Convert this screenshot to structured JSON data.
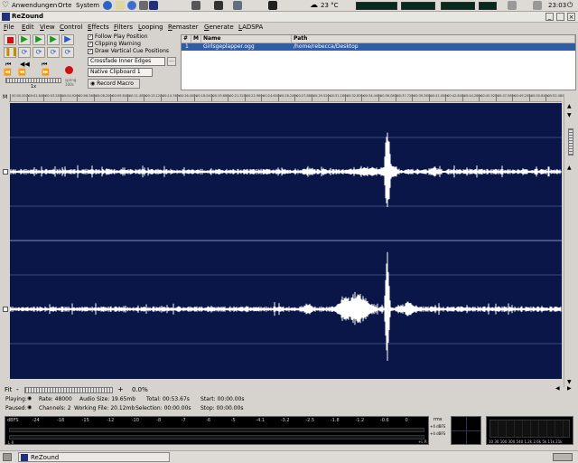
{
  "top_panel": {
    "menus": [
      "Anwendungen",
      "Orte",
      "System"
    ],
    "weather": "23 °C",
    "clock": "23:03"
  },
  "window": {
    "title": "ReZound"
  },
  "menubar": [
    "File",
    "Edit",
    "View",
    "Control",
    "Effects",
    "Filters",
    "Looping",
    "Remaster",
    "Generate",
    "LADSPA"
  ],
  "options": {
    "follow_play": "Follow Play Position",
    "clipping": "Clipping Warning",
    "vertical_cue": "Draw Vertical Cue Positions",
    "crossfade": "Crossfade Inner Edges",
    "clipboard": "Native Clipboard 1",
    "record_macro": "Record Macro",
    "more": "..."
  },
  "shuttle": {
    "label_left": "1x",
    "label_right": "spring\n100s"
  },
  "file_list": {
    "headers": [
      "#",
      "M",
      "Name",
      "Path"
    ],
    "rows": [
      {
        "num": "1",
        "name": "Girlsgeplapper.ogg",
        "path": "/home/rebecca/Desktop"
      }
    ]
  },
  "ruler_ticks": [
    "00:00.000s",
    "00:01.640s",
    "00:03.280s",
    "00:04.920s",
    "00:06.560s",
    "00:08.200s",
    "00:09.840s",
    "00:11.480s",
    "00:13.120s",
    "00:14.760s",
    "00:16.400s",
    "00:18.040s",
    "00:19.680s",
    "00:21.320s",
    "00:22.960s",
    "00:24.600s",
    "00:26.240s",
    "00:27.880s",
    "00:29.520s",
    "00:31.160s",
    "00:32.800s",
    "00:34.440s",
    "00:36.080s",
    "00:37.720s",
    "00:39.360s",
    "00:41.000s",
    "00:42.640s",
    "00:44.280s",
    "00:45.920s",
    "00:47.560s",
    "00:49.200s",
    "00:50.840s",
    "00:52.480s"
  ],
  "zoom": {
    "fit": "Fit",
    "minus": "-",
    "plus": "+",
    "percent": "0.0%"
  },
  "status": {
    "playing": "Playing:",
    "paused": "Paused:",
    "rate": "Rate: 48000",
    "channels": "Channels: 2",
    "audio_size": "Audio Size: 19.65mb",
    "working_file": "Working File: 20.12mb",
    "total": "Total: 00:53.67s",
    "selection": "Selection: 00:00.00s",
    "start": "Start: 00:00.00s",
    "stop": "Stop: 00:00.00s"
  },
  "meter_scale": [
    "dBFS",
    "-24",
    "-18",
    "-15",
    "-12",
    "-10",
    "-8",
    "-7",
    "-6",
    "-5",
    "-4.1",
    "-3.2",
    "-2.5",
    "-1.8",
    "-1.2",
    "-0.6",
    "0"
  ],
  "meter_side": {
    "rms": "rms",
    "peak1": "+4 dBFS",
    "peak2": "+4 dBFS",
    "lr_left": "L R",
    "lr_right": "+L R"
  },
  "spectrum_labels": "10 30 100 300 540 1.2k 2.6k 5k 11k 21k",
  "taskbar": {
    "window": "ReZound"
  },
  "colors": {
    "wave_bg": "#0b1648",
    "wave_fg": "#ffffff",
    "selected_row": "#315da5"
  }
}
